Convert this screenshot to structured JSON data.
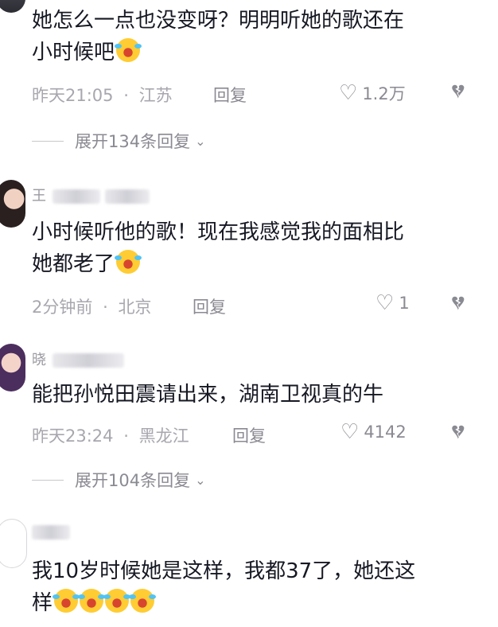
{
  "comments": [
    {
      "text_line1": "她怎么一点也没变呀？明明听她的歌还在",
      "text_line2": "小时候吧",
      "time": "昨天21:05",
      "location": "江苏",
      "reply_label": "回复",
      "likes": "1.2万",
      "expand_label": "展开134条回复"
    },
    {
      "username": "王",
      "text_line1": "小时候听他的歌！现在我感觉我的面相比",
      "text_line2": "她都老了",
      "time": "2分钟前",
      "location": "北京",
      "reply_label": "回复",
      "likes": "1"
    },
    {
      "username": "晓",
      "text_line1": "能把孙悦田震请出来，湖南卫视真的牛",
      "time": "昨天23:24",
      "location": "黑龙江",
      "reply_label": "回复",
      "likes": "4142",
      "expand_label": "展开104条回复"
    },
    {
      "username": "",
      "text_line1": "我10岁时候她是这样，我都37了，她还这",
      "text_line2": "样"
    }
  ],
  "meta_separator": "·",
  "icons": {
    "like": "heart-outline-icon",
    "dislike": "broken-heart-icon",
    "expand": "chevron-down-icon",
    "emoji": "laugh-cry-emoji"
  }
}
